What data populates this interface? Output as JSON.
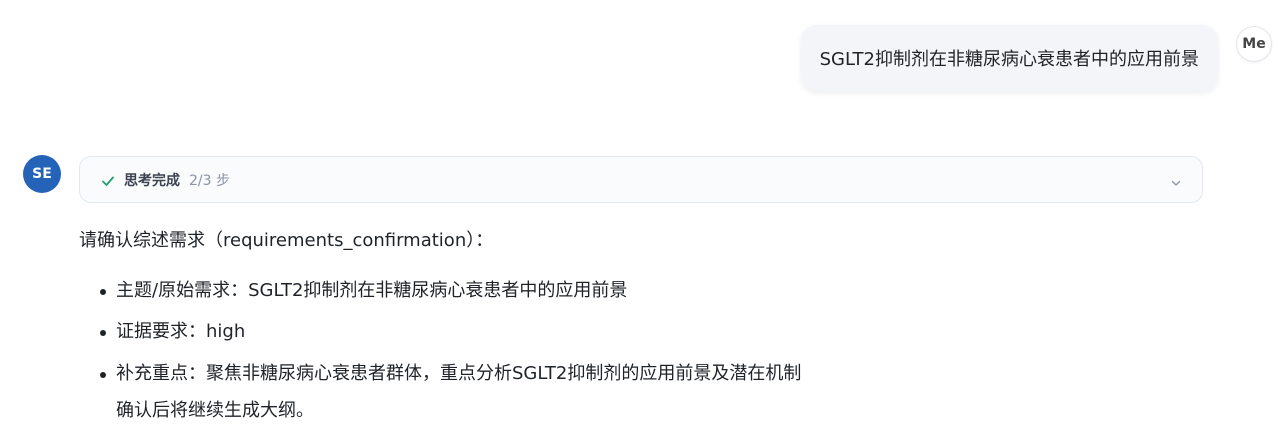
{
  "user": {
    "avatar_label": "Me",
    "message": "SGLT2抑制剂在非糖尿病心衰患者中的应用前景"
  },
  "assistant": {
    "avatar_label": "SE",
    "thinking": {
      "status_icon": "check-icon",
      "title": "思考完成",
      "steps": "2/3 步",
      "toggle_icon": "chevron-down-icon",
      "accent_color": "#22a06b"
    },
    "answer": {
      "intro": "请确认综述需求（requirements_confirmation）：",
      "items": [
        "主题/原始需求：SGLT2抑制剂在非糖尿病心衰患者中的应用前景",
        "证据要求：high",
        "补充重点：聚焦非糖尿病心衰患者群体，重点分析SGLT2抑制剂的应用前景及潜在机制"
      ],
      "footer": "确认后将继续生成大纲。"
    }
  },
  "colors": {
    "bot_avatar": "#2563b8",
    "user_bubble": "#f3f5f8"
  }
}
